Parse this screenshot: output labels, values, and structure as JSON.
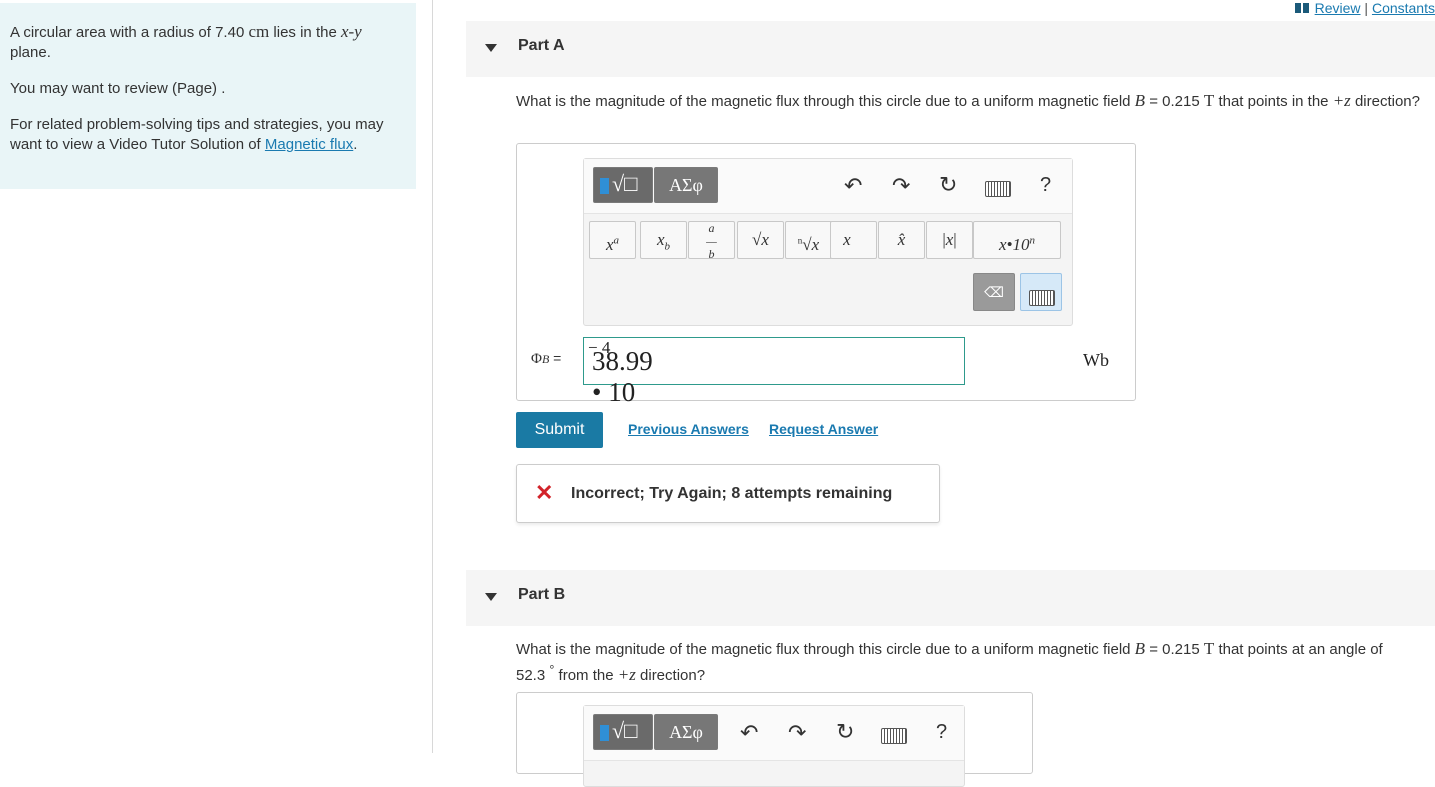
{
  "nav": {
    "review": "Review",
    "separator": "|",
    "constants": "Constants"
  },
  "intro": {
    "p1_pre": "A circular area with a radius of 7.40",
    "p1_unit": "cm",
    "p1_mid": "lies in the",
    "p1_var": "x-y",
    "p1_post": "plane.",
    "p2": "You may want to review (Page) .",
    "p3_pre": "For related problem-solving tips and strategies, you may want to view a Video Tutor Solution of",
    "p3_link": "Magnetic flux",
    "p3_post": "."
  },
  "partA": {
    "label": "Part A",
    "q_pre": "What is the magnitude of the magnetic flux through this circle due to a uniform magnetic field",
    "q_var": "B",
    "q_eq": "= 0.215",
    "q_unit": "T",
    "q_mid": "that points in the",
    "q_dir": "+z",
    "q_post": "direction?",
    "answer_label": "ΦB =",
    "answer_label_main": "Φ",
    "answer_label_sub": "B",
    "answer_label_eq": "=",
    "answer_value": "38.99 • 10",
    "answer_exp": "− 4",
    "unit": "Wb",
    "submit": "Submit",
    "prev_answers": "Previous Answers",
    "request_answer": "Request Answer",
    "feedback": "Incorrect; Try Again; 8 attempts remaining"
  },
  "toolbar": {
    "greek": "ΑΣφ",
    "help": "?",
    "keys": {
      "power": "xa",
      "subscript": "xb",
      "fraction": "a/b",
      "sqrt": "√x",
      "nthroot": "n√x",
      "vector": "x→",
      "hat": "x̂",
      "abs": "|x|",
      "sci": "x•10n"
    }
  },
  "partB": {
    "label": "Part B",
    "q_pre": "What is the magnitude of the magnetic flux through this circle due to a uniform magnetic field",
    "q_var": "B",
    "q_eq": "= 0.215",
    "q_unit": "T",
    "q_mid": "that points at an angle of 52.3",
    "q_deg": "°",
    "q_from": "from the",
    "q_dir": "+z",
    "q_post": "direction?"
  },
  "colors": {
    "accent": "#1a7aa4",
    "intro_bg": "#e9f5f7",
    "error": "#d2232a",
    "input_border": "#2e9a8c"
  }
}
